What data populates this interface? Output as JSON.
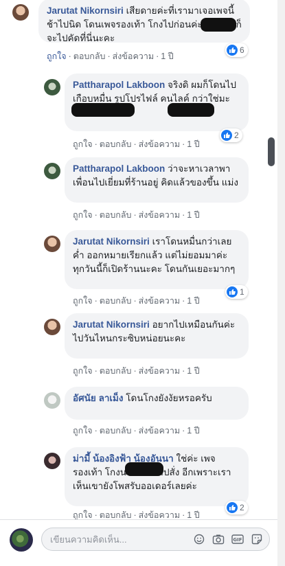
{
  "comments": [
    {
      "name": "Jarutat Nikornsiri",
      "text": "เสียดายค่ะที่เรามาเจอเพจนี้ช้าไปนิด โดนเพจรองเท้า โกงไปก่อนค่ะ แต่ยังไงก็จะไปคัดที่นี่นะคะ",
      "like": "ถูกใจ",
      "reply": "ตอบกลับ",
      "share": "ส่งข้อความ",
      "time": "1 ปี",
      "reactions": "6"
    },
    {
      "name": "Pattharapol Lakboon",
      "text": "จริงดิ ผมก็โดนไปเกือบหมื่น รูปโปรไฟล์ คนไลค์ กว่าใช่มะ",
      "like": "ถูกใจ",
      "reply": "ตอบกลับ",
      "share": "ส่งข้อความ",
      "time": "1 ปี",
      "reactions": "2"
    },
    {
      "name": "Pattharapol Lakboon",
      "text": "ว่าจะหาเวลาพาเพื่อนไปเยี่ยมที่ร้านอยู่ คิดแล้วของขึ้น แม่ง",
      "like": "ถูกใจ",
      "reply": "ตอบกลับ",
      "share": "ส่งข้อความ",
      "time": "1 ปี"
    },
    {
      "name": "Jarutat Nikornsiri",
      "text": "เราโดนหมื่นกว่าเลยค่ำ ออกหมายเรียกแล้ว แต่ไม่ยอมมาค่ะ ทุกวันนี้ก็เปิดร้านนะคะ โดนกันเยอะมากๆ",
      "like": "ถูกใจ",
      "reply": "ตอบกลับ",
      "share": "ส่งข้อความ",
      "time": "1 ปี",
      "reactions": "1"
    },
    {
      "name": "Jarutat Nikornsiri",
      "text": "อยากไปเหมือนกันค่ะ ไปวันไหนกระซิบหน่อยนะคะ",
      "like": "ถูกใจ",
      "reply": "ตอบกลับ",
      "share": "ส่งข้อความ",
      "time": "1 ปี"
    },
    {
      "name": "อัศนัย ลาเม็ง",
      "text": "โดนโกงยังงัยหรอครับ",
      "like": "ถูกใจ",
      "reply": "ตอบกลับ",
      "share": "ส่งข้อความ",
      "time": "1 ปี"
    },
    {
      "name": "ม่ามี้ น้องอิงฟ้า น้องอันนา",
      "text": "ใช่ค่ะ เพจรองเท้า โกงนะคะอย่าไปสั่ง อีกเพราะเราเห็นเขายังโพสรับออเดอร์เลยค่ะ",
      "like": "ถูกใจ",
      "reply": "ตอบกลับ",
      "share": "ส่งข้อความ",
      "time": "1 ปี",
      "reactions": "2"
    }
  ],
  "composer": {
    "placeholder": "เขียนความคิดเห็น..."
  },
  "colors": {
    "name": "#385898",
    "bubble": "#f2f3f5",
    "like": "#1877f2"
  }
}
